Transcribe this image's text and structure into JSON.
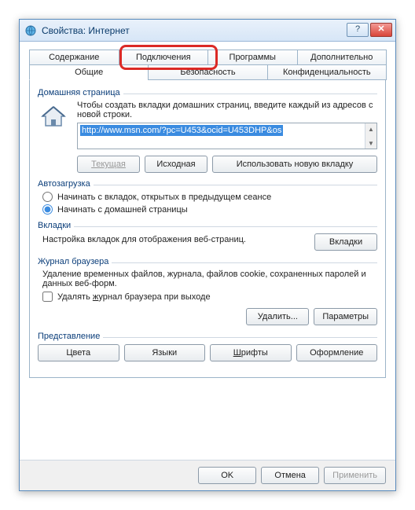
{
  "window": {
    "title": "Свойства: Интернет"
  },
  "tabs": {
    "back": [
      "Содержание",
      "Подключения",
      "Программы",
      "Дополнительно"
    ],
    "front": [
      "Общие",
      "Безопасность",
      "Конфиденциальность"
    ]
  },
  "home": {
    "label": "Домашняя страница",
    "hint": "Чтобы создать вкладки домашних страниц, введите каждый из адресов с новой строки.",
    "url": "http://www.msn.com/?pc=U453&ocid=U453DHP&os",
    "btn_current": "Текущая",
    "btn_default": "Исходная",
    "btn_newtab": "Использовать новую вкладку"
  },
  "autoload": {
    "label": "Автозагрузка",
    "opt_tabs": "Начинать с вкладок, открытых в предыдущем сеансе",
    "opt_home": "Начинать с домашней страницы"
  },
  "tabs_section": {
    "label": "Вкладки",
    "desc": "Настройка вкладок для отображения веб-страниц.",
    "btn": "Вкладки"
  },
  "history": {
    "label": "Журнал браузера",
    "desc": "Удаление временных файлов, журнала, файлов cookie, сохраненных паролей и данных веб-форм.",
    "chk": "Удалять журнал браузера при выходе",
    "btn_delete": "Удалить...",
    "btn_params": "Параметры"
  },
  "appearance": {
    "label": "Представление",
    "btn_colors": "Цвета",
    "btn_lang": "Языки",
    "btn_fonts": "Шрифты",
    "btn_access": "Оформление"
  },
  "footer": {
    "ok": "OK",
    "cancel": "Отмена",
    "apply": "Применить"
  }
}
